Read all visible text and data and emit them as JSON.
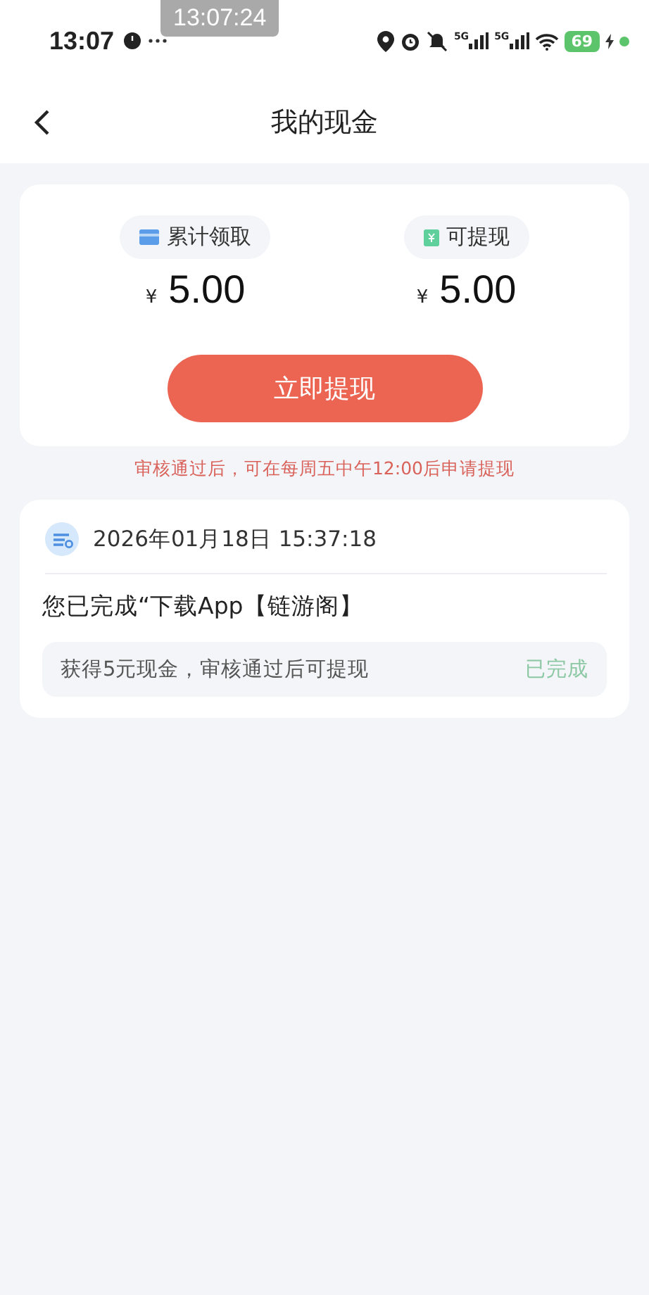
{
  "status_bar": {
    "time": "13:07",
    "time_overlay": "13:07:24",
    "network_labels": [
      "5G",
      "5G"
    ],
    "battery": "69"
  },
  "header": {
    "title": "我的现金"
  },
  "summary": {
    "stats": [
      {
        "kind": "total",
        "label": "累计领取",
        "currency": "¥",
        "amount": "5.00"
      },
      {
        "kind": "withdrawable",
        "label": "可提现",
        "currency": "¥",
        "amount": "5.00"
      }
    ],
    "button": "立即提现"
  },
  "notice": "审核通过后，可在每周五中午12:00后申请提现",
  "records": [
    {
      "datetime": "2026年01月18日 15:37:18",
      "description": "您已完成“下载App【链游阁】",
      "detail": "获得5元现金，审核通过后可提现",
      "status": "已完成"
    }
  ]
}
